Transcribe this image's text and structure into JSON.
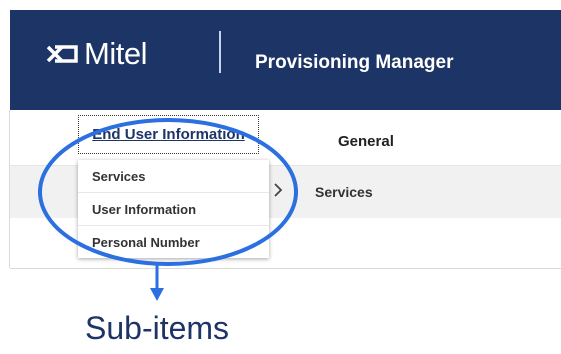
{
  "header": {
    "logo_text": "Mitel",
    "app_title": "Provisioning Manager",
    "background": "#1d3566"
  },
  "nav": {
    "tabs": [
      "End User Information",
      "General"
    ],
    "sub_tab": "Services"
  },
  "dropdown": {
    "items": [
      "Services",
      "User Information",
      "Personal Number"
    ]
  },
  "annotation": {
    "label": "Sub-items",
    "color": "#2b6fe0"
  }
}
